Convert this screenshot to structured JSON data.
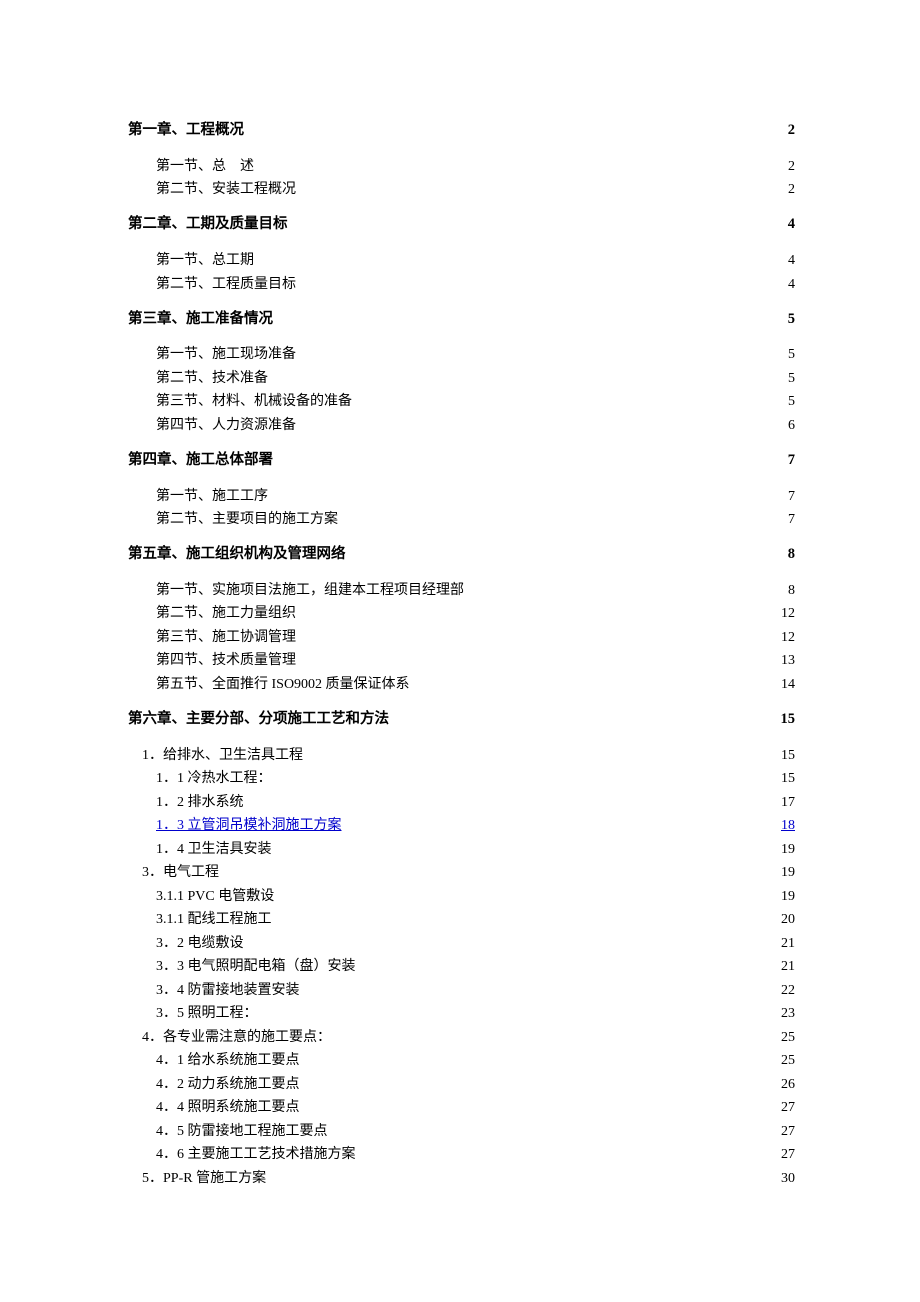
{
  "entries": [
    {
      "level": "chapter",
      "title": "第一章、工程概况",
      "page": "2"
    },
    {
      "level": "section",
      "title": "第一节、总　述",
      "page": "2"
    },
    {
      "level": "section",
      "title": "第二节、安装工程概况",
      "page": "2"
    },
    {
      "level": "chapter",
      "title": "第二章、工期及质量目标",
      "page": "4"
    },
    {
      "level": "section",
      "title": "第一节、总工期",
      "page": "4"
    },
    {
      "level": "section",
      "title": "第二节、工程质量目标",
      "page": "4"
    },
    {
      "level": "chapter",
      "title": "第三章、施工准备情况",
      "page": "5"
    },
    {
      "level": "section",
      "title": "第一节、施工现场准备",
      "page": "5"
    },
    {
      "level": "section",
      "title": "第二节、技术准备",
      "page": "5"
    },
    {
      "level": "section",
      "title": "第三节、材料、机械设备的准备",
      "page": "5"
    },
    {
      "level": "section",
      "title": "第四节、人力资源准备",
      "page": "6"
    },
    {
      "level": "chapter",
      "title": "第四章、施工总体部署",
      "page": "7"
    },
    {
      "level": "section",
      "title": "第一节、施工工序",
      "page": "7"
    },
    {
      "level": "section",
      "title": "第二节、主要项目的施工方案",
      "page": "7"
    },
    {
      "level": "chapter",
      "title": "第五章、施工组织机构及管理网络",
      "page": "8"
    },
    {
      "level": "section",
      "title": "第一节、实施项目法施工，组建本工程项目经理部",
      "page": "8"
    },
    {
      "level": "section",
      "title": "第二节、施工力量组织",
      "page": "12"
    },
    {
      "level": "section",
      "title": "第三节、施工协调管理",
      "page": "12"
    },
    {
      "level": "section",
      "title": "第四节、技术质量管理",
      "page": "13"
    },
    {
      "level": "section",
      "title": "第五节、全面推行 ISO9002 质量保证体系",
      "page": "14"
    },
    {
      "level": "chapter",
      "title": "第六章、主要分部、分项施工工艺和方法",
      "page": "15"
    },
    {
      "level": "subsection",
      "title": "1．给排水、卫生洁具工程",
      "page": "15"
    },
    {
      "level": "subsubsection",
      "title": "1．1 冷热水工程：",
      "page": "15"
    },
    {
      "level": "subsubsection",
      "title": "1．2 排水系统",
      "page": "17"
    },
    {
      "level": "subsubsection",
      "title": "1．3 立管洞吊模补洞施工方案",
      "page": "18",
      "link": true
    },
    {
      "level": "subsubsection",
      "title": "1．4 卫生洁具安装",
      "page": "19"
    },
    {
      "level": "subsection",
      "title": "3．电气工程",
      "page": "19"
    },
    {
      "level": "subsubsection",
      "title": "3.1.1 PVC 电管敷设",
      "page": "19"
    },
    {
      "level": "subsubsection",
      "title": "3.1.1 配线工程施工",
      "page": "20"
    },
    {
      "level": "subsubsection",
      "title": "3．2 电缆敷设",
      "page": "21"
    },
    {
      "level": "subsubsection",
      "title": "3．3 电气照明配电箱（盘）安装",
      "page": "21"
    },
    {
      "level": "subsubsection",
      "title": "3．4 防雷接地装置安装",
      "page": "22"
    },
    {
      "level": "subsubsection",
      "title": "3．5 照明工程：",
      "page": "23"
    },
    {
      "level": "subsection",
      "title": "4．各专业需注意的施工要点：",
      "page": "25"
    },
    {
      "level": "subsubsection",
      "title": "4．1 给水系统施工要点",
      "page": "25"
    },
    {
      "level": "subsubsection",
      "title": "4．2 动力系统施工要点",
      "page": "26"
    },
    {
      "level": "subsubsection",
      "title": "4．4 照明系统施工要点",
      "page": "27"
    },
    {
      "level": "subsubsection",
      "title": "4．5 防雷接地工程施工要点",
      "page": "27"
    },
    {
      "level": "subsubsection",
      "title": "4．6 主要施工工艺技术措施方案",
      "page": "27"
    },
    {
      "level": "subsection",
      "title": "5．PP-R 管施工方案",
      "page": "30"
    }
  ]
}
